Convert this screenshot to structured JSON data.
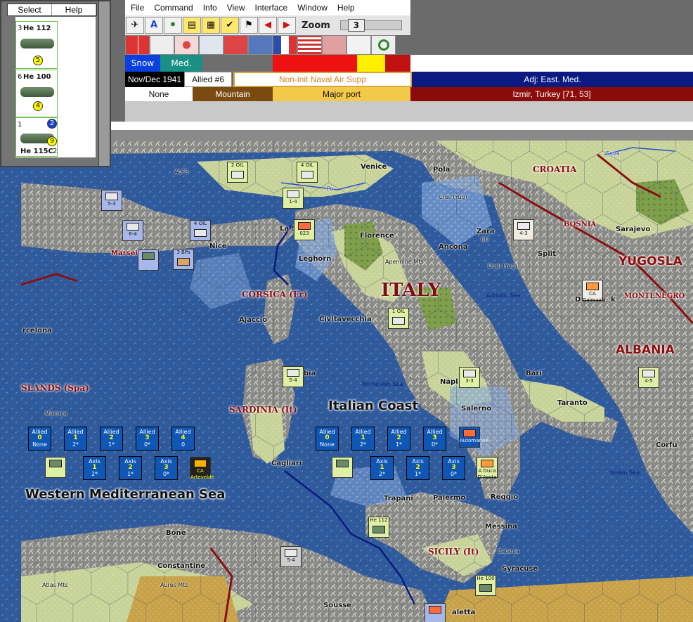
{
  "side_panel": {
    "select_label": "Select",
    "help_label": "Help",
    "units": [
      {
        "num": "3",
        "name": "He 112",
        "value": "5"
      },
      {
        "num": "6",
        "name": "He 100",
        "value": "4"
      },
      {
        "num": "1",
        "name": "He 115C",
        "value": "9",
        "extra": "2",
        "extra2": "2"
      }
    ]
  },
  "menu": [
    "File",
    "Command",
    "Info",
    "View",
    "Interface",
    "Window",
    "Help"
  ],
  "zoom": {
    "label": "Zoom",
    "value": "3"
  },
  "terrain_bar": {
    "snow": "Snow",
    "med": "Med."
  },
  "info_row": {
    "date": "Nov/Dec 1941",
    "turn": "Allied #6",
    "supply": "Non-init Naval Air Supp",
    "adjacent": "Adj: East. Med."
  },
  "hex_row": {
    "none": "None",
    "terrain": "Mountain",
    "port": "Major port",
    "location": "Izmir, Turkey [71, 53]"
  },
  "colors": {
    "snow": "#0b3fe0",
    "med": "#1a8f83",
    "supply_border": "#d9a23a",
    "adjacent_bg": "#0a1a80",
    "location_bg": "#8b0a0a",
    "mountain": "#7a4a10",
    "port": "#f3c94a"
  },
  "map_labels": {
    "alps": "ALPS",
    "croatia": "CROATIA",
    "bosnia": "BOSNIA",
    "yugosla": "YUGOSLA",
    "montenegro": "MONTENEGRO",
    "albania": "ALBANIA",
    "italy": "ITALY",
    "corsica": "CORSICA (Fr)",
    "sardinia": "SARDINIA (It)",
    "sicily": "SICILY (It)",
    "islands": "SLANDS (Spa)",
    "italian_coast": "Italian Coast",
    "wmed": "Western Mediterranean Sea",
    "adriatic": "Adriatic Sea",
    "tyrrhenian": "Tyrrhenian Sea",
    "ionian": "Ionian Sea",
    "apennine": "Apennine Mts",
    "atlas": "Atlas Mts",
    "aures": "Aurès Mts",
    "venice": "Venice",
    "pola": "Pola",
    "cres": "Cres (Yug)",
    "zara": "Zara",
    "zara_it": "(It)",
    "dugi": "Dugi (Yug)",
    "split": "Split",
    "sarajevo": "Sarajevo",
    "ancona": "Ancona",
    "florence": "Florence",
    "leghorn": "Leghorn",
    "nice": "Nice",
    "marseille": "Marsei",
    "lasp": "La Sp",
    "ajaccio": "Ajaccio",
    "civitavecchia": "Civitavecchia",
    "cagliari": "Cagliari",
    "naples": "Napl",
    "salerno": "Salerno",
    "bari": "Bari",
    "taranto": "Taranto",
    "trapani": "Trapani",
    "palermo": "Palermo",
    "reggio": "Reggio",
    "messina": "Messina",
    "catania": "Catania",
    "syracuse": "Syracuse",
    "valletta": "aletta",
    "corfu": "Corfu",
    "bone": "Bone",
    "constantine": "Constantine",
    "sousse": "Sousse",
    "barcelona": "rcelona",
    "minorca": "Minorca",
    "dubrovnik_a": "D",
    "dubrovnik_b": "k",
    "sava": "Sava",
    "po": "Po",
    "bia": "bia"
  },
  "counters": [
    {
      "id": "oil2",
      "text": "2 OIL"
    },
    {
      "id": "oil4a",
      "text": "4 OIL"
    },
    {
      "id": "oil4b",
      "text": "4 OIL"
    },
    {
      "id": "oil1",
      "text": "1 OIL"
    },
    {
      "id": "bps",
      "text": "3 BPs"
    },
    {
      "id": "c53",
      "text": "5-3"
    },
    {
      "id": "c64",
      "text": "6-4"
    },
    {
      "id": "c14",
      "text": "1-4"
    },
    {
      "id": "c43",
      "text": "4-3"
    },
    {
      "id": "c33",
      "text": "3-3"
    },
    {
      "id": "c45",
      "text": "4-5"
    },
    {
      "id": "c54",
      "text": "5-4"
    },
    {
      "id": "c54b",
      "text": "5-4"
    },
    {
      "id": "c23",
      "text": "023"
    },
    {
      "id": "cdalm",
      "text": "CA Dalmazia"
    },
    {
      "id": "cartev",
      "text": "CA Artevelde"
    },
    {
      "id": "cdaosta",
      "text": "A Duca D'Aosta"
    },
    {
      "id": "cautom",
      "text": "Automarine"
    },
    {
      "id": "che112",
      "text": "He 112"
    },
    {
      "id": "che100",
      "text": "He 100"
    }
  ],
  "naval_boxes_west": {
    "allied": [
      {
        "label": "Allied",
        "num": "0",
        "sub": "None"
      },
      {
        "label": "Allied",
        "num": "1",
        "sub": "2*"
      },
      {
        "label": "Allied",
        "num": "2",
        "sub": "1*"
      },
      {
        "label": "Allied",
        "num": "3",
        "sub": "0*"
      },
      {
        "label": "Allied",
        "num": "4",
        "sub": "0"
      }
    ],
    "axis": [
      {
        "label": "Axis",
        "num": "1",
        "sub": "2*"
      },
      {
        "label": "Axis",
        "num": "2",
        "sub": "1*"
      },
      {
        "label": "Axis",
        "num": "3",
        "sub": "0*"
      }
    ]
  },
  "naval_boxes_east": {
    "allied": [
      {
        "label": "Allied",
        "num": "0",
        "sub": "None"
      },
      {
        "label": "Allied",
        "num": "1",
        "sub": "2*"
      },
      {
        "label": "Allied",
        "num": "2",
        "sub": "1*"
      },
      {
        "label": "Allied",
        "num": "3",
        "sub": "0*"
      }
    ],
    "axis": [
      {
        "label": "Axis",
        "num": "1",
        "sub": "2*"
      },
      {
        "label": "Axis",
        "num": "2",
        "sub": "1*"
      },
      {
        "label": "Axis",
        "num": "3",
        "sub": "0*"
      }
    ]
  }
}
